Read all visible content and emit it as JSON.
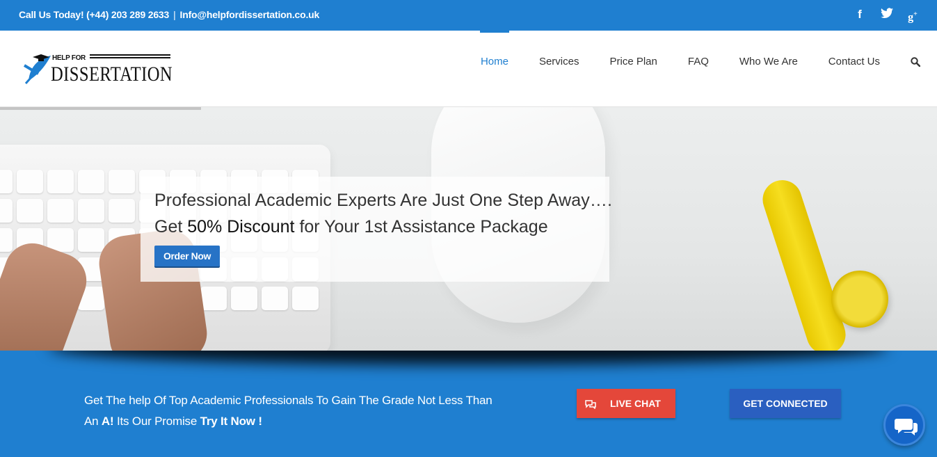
{
  "topbar": {
    "phone": "Call Us Today! (+44) 203 289 2633",
    "separator": "|",
    "email": "Info@helpfordissertation.co.uk",
    "social": [
      "facebook-icon",
      "twitter-icon",
      "google-plus-icon"
    ]
  },
  "logo": {
    "top_text": "HELP FOR",
    "main_text": "DISSERTATION"
  },
  "nav": {
    "items": [
      "Home",
      "Services",
      "Price Plan",
      "FAQ",
      "Who We Are",
      "Contact Us"
    ],
    "active": "Home"
  },
  "hero": {
    "headline": "Professional Academic Experts Are Just One Step Away….",
    "offer_prefix": "Get ",
    "offer_highlight": "50% Discount",
    "offer_suffix": " for Your 1st Assistance Package",
    "order_button": "Order Now"
  },
  "band": {
    "line1": "Get The help Of Top Academic Professionals To Gain The Grade Not Less Than",
    "line2_prefix": "An ",
    "line2_grade": "A!",
    "line2_mid": " Its Our Promise ",
    "line2_cta": "Try It Now !",
    "live_chat": "LIVE CHAT",
    "get_connected": "GET CONNECTED"
  },
  "colors": {
    "primary": "#1f7fd0",
    "live_chat": "#e4473a",
    "get_connected": "#2a5fc0",
    "order_button": "#2773c6"
  }
}
